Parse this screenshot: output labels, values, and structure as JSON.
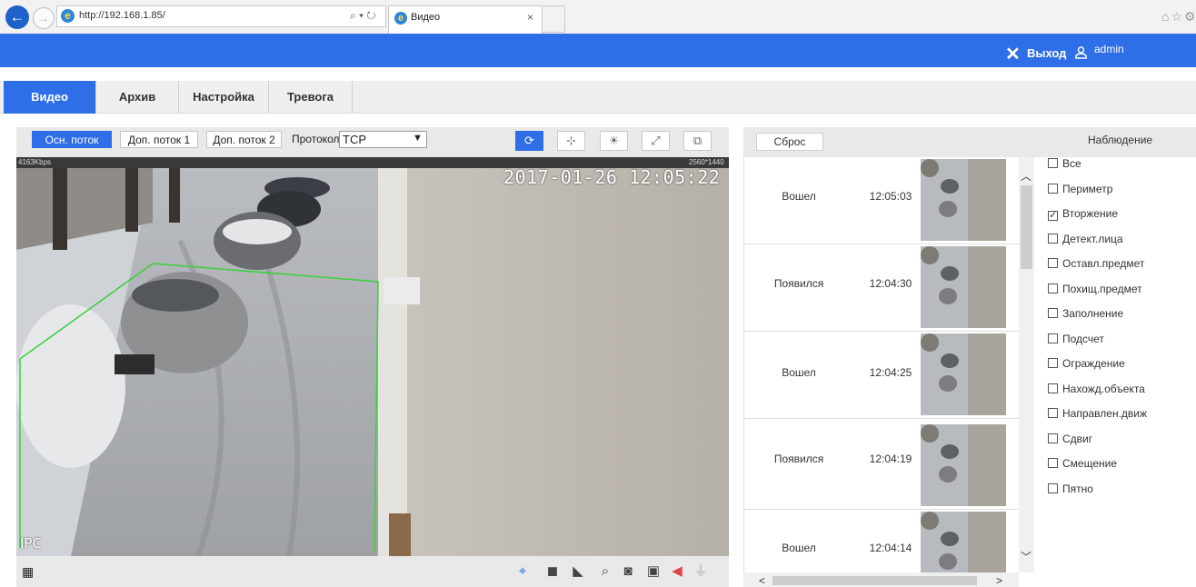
{
  "browser": {
    "back": "←",
    "forward": "→",
    "url": "http://192.168.1.85/",
    "address_tools": "⌕ ▾ ↻",
    "tab_title": "Видео",
    "tab_close": "×",
    "right_icons": "⌂☆⚙"
  },
  "header": {
    "logout_icon": "✕",
    "logout_label": "Выход",
    "user_name": "admin"
  },
  "nav": {
    "tabs": [
      "Видео",
      "Архив",
      "Настройка",
      "Тревога"
    ],
    "active": "Видео"
  },
  "video": {
    "streams": [
      "Осн. поток",
      "Доп. поток 1",
      "Доп. поток 2"
    ],
    "active_stream": "Осн. поток",
    "protocol_label": "Протокол",
    "protocol_value": "TCP",
    "tools": [
      "⟳",
      "⊹",
      "☀",
      "⤢",
      "⧉"
    ],
    "bitrate": "4163Kbps",
    "resolution": "2560*1440",
    "osd_time": "2017-01-26 12:05:22",
    "osd_label": "IPC",
    "bottom_icons": [
      "⌖",
      "◼",
      "◣",
      "⌕",
      "◙",
      "▣",
      "◀",
      "⏚"
    ]
  },
  "events": {
    "reset_label": "Сброс",
    "observe_label": "Наблюдение",
    "rows": [
      {
        "type": "Вошел",
        "time": "12:05:03"
      },
      {
        "type": "Появился",
        "time": "12:04:30"
      },
      {
        "type": "Вошел",
        "time": "12:04:25"
      },
      {
        "type": "Появился",
        "time": "12:04:19"
      },
      {
        "type": "Вошел",
        "time": "12:04:14"
      }
    ]
  },
  "filters": [
    {
      "label": "Все",
      "checked": false
    },
    {
      "label": "Периметр",
      "checked": false
    },
    {
      "label": "Вторжение",
      "checked": true
    },
    {
      "label": "Детект.лица",
      "checked": false
    },
    {
      "label": "Оставл.предмет",
      "checked": false
    },
    {
      "label": "Похищ.предмет",
      "checked": false
    },
    {
      "label": "Заполнение",
      "checked": false
    },
    {
      "label": "Подсчет",
      "checked": false
    },
    {
      "label": "Ограждение",
      "checked": false
    },
    {
      "label": "Нахожд.объекта",
      "checked": false
    },
    {
      "label": "Направлен.движ",
      "checked": false
    },
    {
      "label": "Сдвиг",
      "checked": false
    },
    {
      "label": "Смещение",
      "checked": false
    },
    {
      "label": "Пятно",
      "checked": false
    }
  ],
  "colors": {
    "accent": "#2e6ee6",
    "detection_zone": "#39d13a"
  }
}
